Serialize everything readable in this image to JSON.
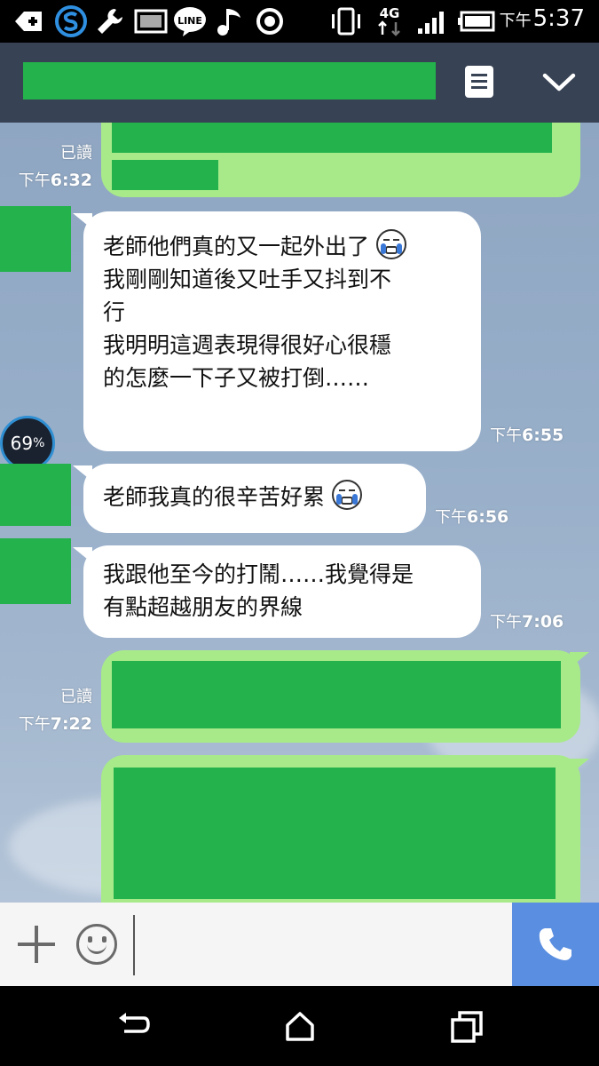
{
  "status_bar": {
    "icons": [
      "add-icon",
      "s-app-icon",
      "wrench-icon",
      "image-icon",
      "line-icon",
      "music-icon",
      "record-icon",
      "vibrate-icon",
      "4g-icon",
      "signal-icon",
      "battery-icon"
    ],
    "network_label": "4G",
    "line_label": "LINE",
    "time_ampm": "下午",
    "time_hm": "5:37"
  },
  "messages": [
    {
      "side": "right",
      "read": "已讀",
      "time_ampm": "下午",
      "time_hm": "6:32"
    },
    {
      "side": "left",
      "lines": [
        "老師他們真的又一起外出了",
        "我剛剛知道後又吐手又抖到不",
        "行",
        "我明明這週表現得很好心很穩",
        "的怎麼一下子又被打倒……"
      ],
      "time_ampm": "下午",
      "time_hm": "6:55"
    },
    {
      "side": "left",
      "lines": [
        "老師我真的很辛苦好累"
      ],
      "time_ampm": "下午",
      "time_hm": "6:56"
    },
    {
      "side": "left",
      "lines": [
        "我跟他至今的打鬧……我覺得是",
        "有點超越朋友的界線"
      ],
      "time_ampm": "下午",
      "time_hm": "7:06"
    },
    {
      "side": "right",
      "read": "已讀",
      "time_ampm": "下午",
      "time_hm": "7:22"
    },
    {
      "side": "right"
    }
  ],
  "badge": {
    "value": "69",
    "unit": "%"
  },
  "input": {
    "placeholder": ""
  },
  "colors": {
    "header": "#374254",
    "redaction": "#23b24b",
    "outgoing_bubble": "#a8ea8a",
    "incoming_bubble": "#ffffff",
    "call_button": "#5a8ee0"
  }
}
